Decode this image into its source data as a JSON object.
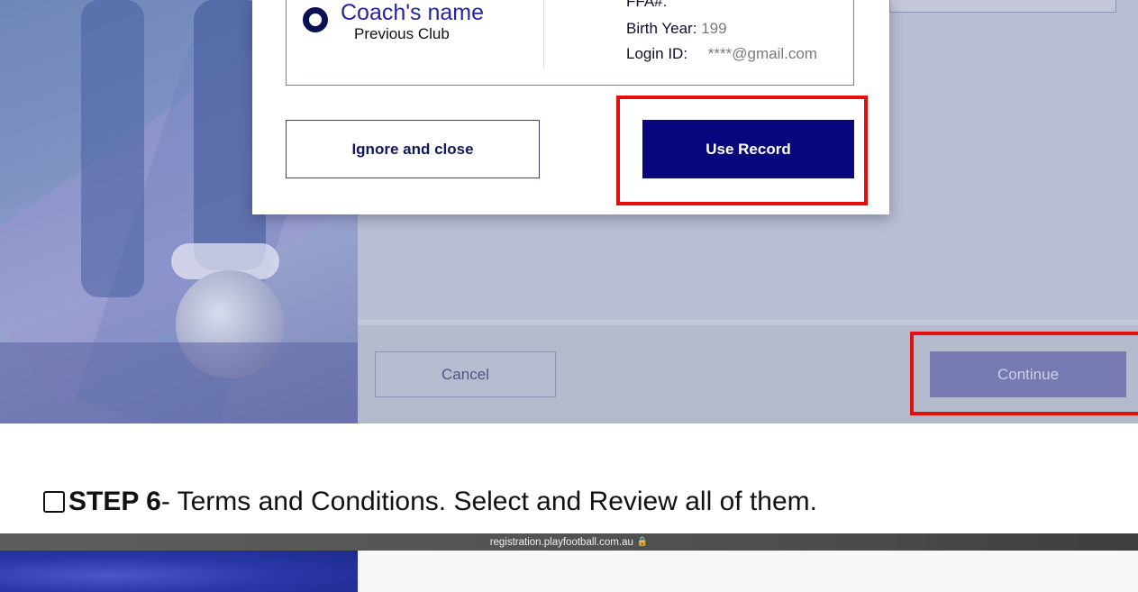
{
  "screenshot_top": {
    "record": {
      "coach_name": "Coach's name",
      "previous_club": "Previous Club",
      "ffa_label": "FFA#:",
      "ffa_value": "",
      "birth_year_label": "Birth Year:",
      "birth_year_value": "199",
      "login_label": "Login ID:",
      "login_value": "****@gmail.com"
    },
    "buttons": {
      "ignore": "Ignore and close",
      "use_record": "Use Record",
      "cancel": "Cancel",
      "continue": "Continue"
    },
    "colors": {
      "highlight": "#e30e0e",
      "primary": "#07087d",
      "continue_disabled": "#7779b2"
    }
  },
  "instruction": {
    "step": "STEP 6",
    "text": " - Terms and Conditions. Select and Review all of them."
  },
  "screenshot_bottom": {
    "url": "registration.playfootball.com.au"
  }
}
